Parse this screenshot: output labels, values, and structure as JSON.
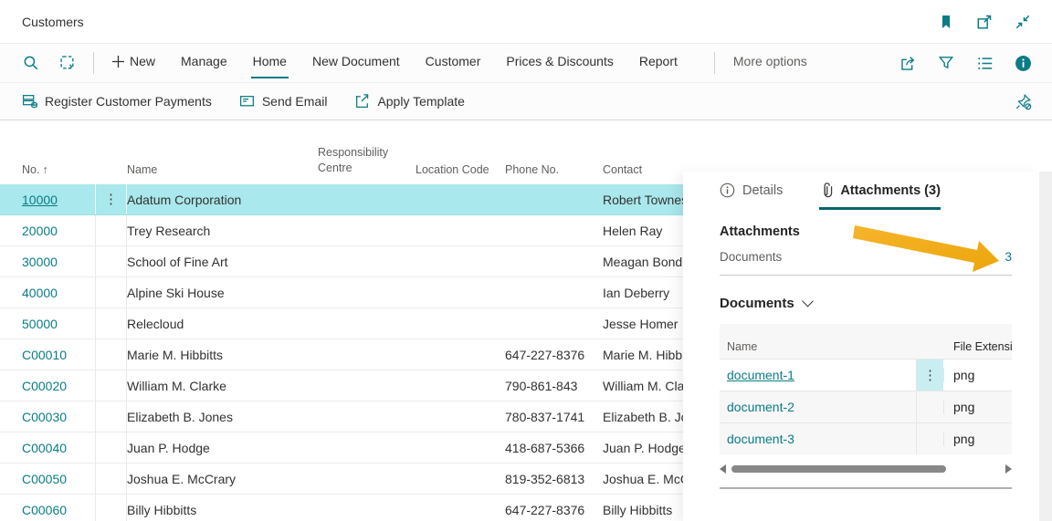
{
  "window": {
    "title": "Customers"
  },
  "icons": {
    "row_menu": "⋮"
  },
  "ribbon": {
    "menu": [
      {
        "label": "New"
      },
      {
        "label": "Manage"
      },
      {
        "label": "Home"
      },
      {
        "label": "New Document"
      },
      {
        "label": "Customer"
      },
      {
        "label": "Prices & Discounts"
      },
      {
        "label": "Report"
      }
    ],
    "active_menu": "Home",
    "more_options": "More options",
    "actions": [
      {
        "label": "Register Customer Payments"
      },
      {
        "label": "Send Email"
      },
      {
        "label": "Apply Template"
      }
    ]
  },
  "customer_table": {
    "columns": {
      "no": "No.",
      "name": "Name",
      "responsibility_centre": "Responsibility Centre",
      "location_code": "Location Code",
      "phone": "Phone No.",
      "contact": "Contact"
    },
    "sort_indicator": "↑",
    "rows": [
      {
        "no": "10000",
        "name": "Adatum Corporation",
        "phone": "",
        "contact": "Robert Townes"
      },
      {
        "no": "20000",
        "name": "Trey Research",
        "phone": "",
        "contact": "Helen Ray"
      },
      {
        "no": "30000",
        "name": "School of Fine Art",
        "phone": "",
        "contact": "Meagan Bond"
      },
      {
        "no": "40000",
        "name": "Alpine Ski House",
        "phone": "",
        "contact": "Ian Deberry"
      },
      {
        "no": "50000",
        "name": "Relecloud",
        "phone": "",
        "contact": "Jesse Homer"
      },
      {
        "no": "C00010",
        "name": "Marie M. Hibbitts",
        "phone": "647-227-8376",
        "contact": "Marie M. Hibbitts"
      },
      {
        "no": "C00020",
        "name": "William M. Clarke",
        "phone": "790-861-843",
        "contact": "William M. Clarke"
      },
      {
        "no": "C00030",
        "name": "Elizabeth B. Jones",
        "phone": "780-837-1741",
        "contact": "Elizabeth B. Jones"
      },
      {
        "no": "C00040",
        "name": "Juan P. Hodge",
        "phone": "418-687-5366",
        "contact": "Juan P. Hodge"
      },
      {
        "no": "C00050",
        "name": "Joshua E. McCrary",
        "phone": "819-352-6813",
        "contact": "Joshua E. McCrary"
      },
      {
        "no": "C00060",
        "name": "Billy Hibbitts",
        "phone": "647-227-8376",
        "contact": "Billy Hibbitts"
      }
    ]
  },
  "factbox": {
    "tabs": [
      {
        "label": "Details"
      },
      {
        "label": "Attachments (3)"
      }
    ],
    "active_tab": "Attachments (3)",
    "attachments": {
      "heading": "Attachments",
      "field_label": "Documents",
      "field_value": "3"
    },
    "documents_section": {
      "title": "Documents",
      "columns": {
        "name": "Name",
        "file_extension": "File Extension"
      },
      "rows": [
        {
          "name": "document-1",
          "ext": "png"
        },
        {
          "name": "document-2",
          "ext": "png"
        },
        {
          "name": "document-3",
          "ext": "png"
        }
      ]
    }
  },
  "colors": {
    "accent_teal": "#0a7c86",
    "tab_underline": "#06656d",
    "row_selection": "#a9e8ec",
    "annotation_arrow": "#f2ab13"
  }
}
